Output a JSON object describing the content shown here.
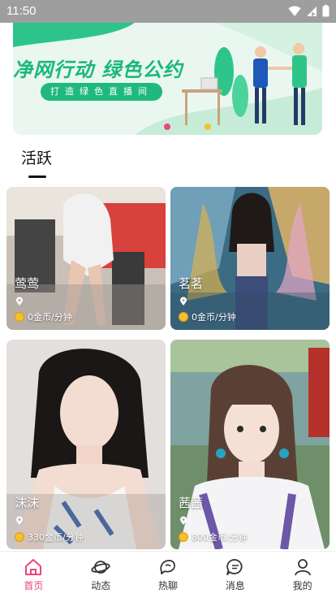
{
  "status_bar": {
    "time": "11:50"
  },
  "banner": {
    "title": "净网行动  绿色公约",
    "subtitle": "打造绿色直播间"
  },
  "section": {
    "title": "活跃"
  },
  "cards": [
    {
      "name": "莺莺",
      "price": "0金币/分钟"
    },
    {
      "name": "茗茗",
      "price": "0金币/分钟"
    },
    {
      "name": "沫沫",
      "price": "330金币/分钟"
    },
    {
      "name": "茜茜",
      "price": "800金币/分钟"
    }
  ],
  "tabs": [
    {
      "label": "首页",
      "icon": "home-icon",
      "active": true
    },
    {
      "label": "动态",
      "icon": "planet-icon",
      "active": false
    },
    {
      "label": "热聊",
      "icon": "chat-bubbles-icon",
      "active": false
    },
    {
      "label": "消息",
      "icon": "message-icon",
      "active": false
    },
    {
      "label": "我的",
      "icon": "person-icon",
      "active": false
    }
  ],
  "colors": {
    "accent": "#e8477a",
    "banner_green": "#1fb97e",
    "status_bar": "#9e9e9e"
  }
}
